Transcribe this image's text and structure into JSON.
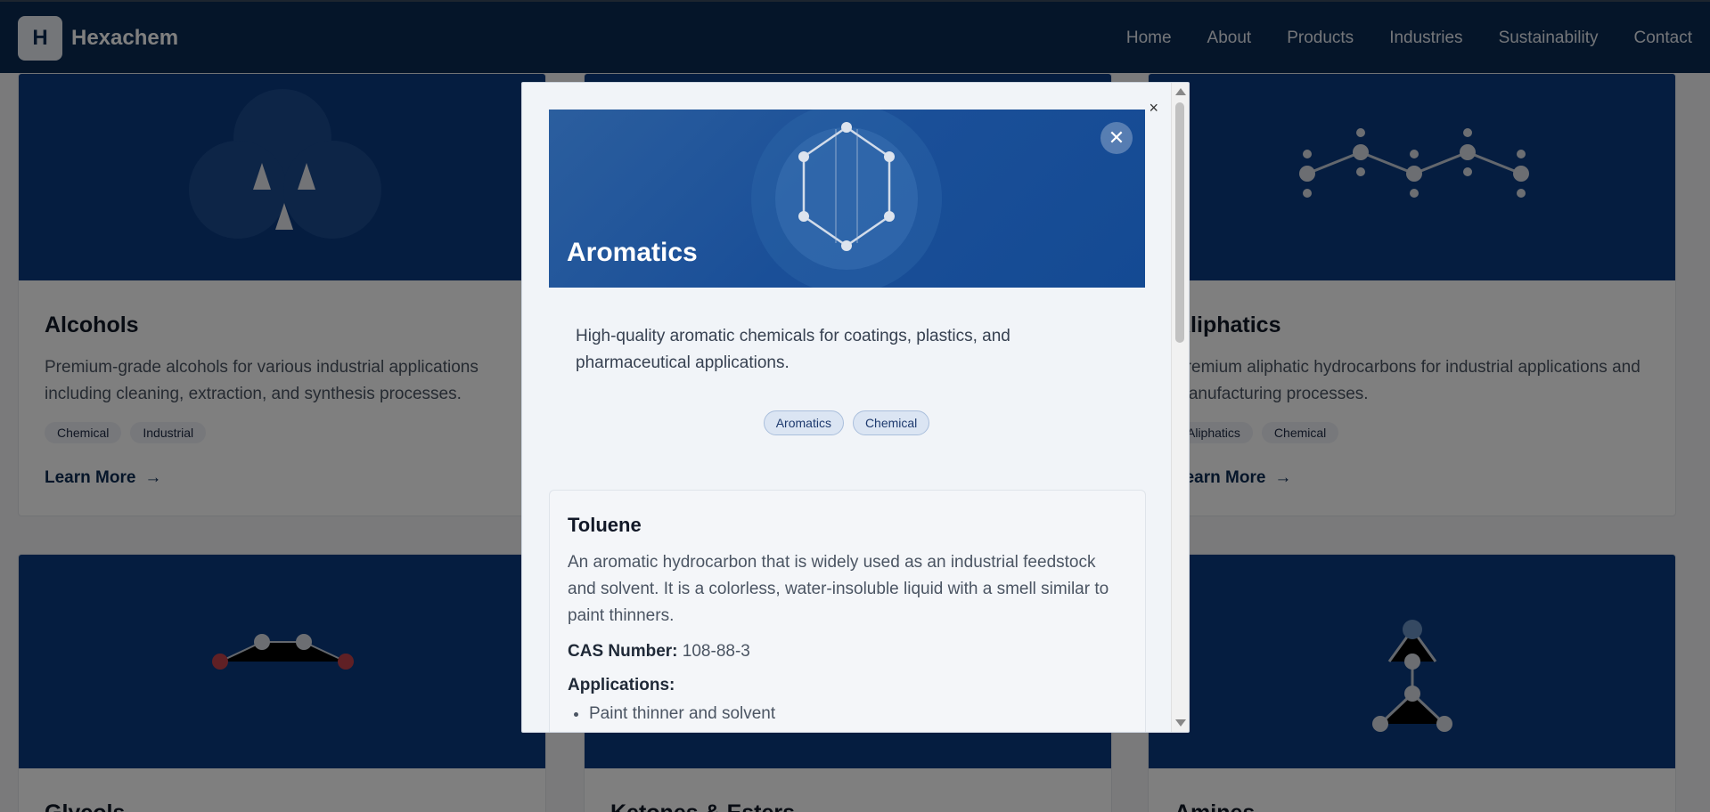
{
  "nav": {
    "logo_letter": "H",
    "brand": "Hexachem",
    "links": [
      "Home",
      "About",
      "Products",
      "Industries",
      "Sustainability",
      "Contact"
    ]
  },
  "cards": [
    {
      "title": "Alcohols",
      "desc": "Premium-grade alcohols for various industrial applications including cleaning, extraction, and synthesis processes.",
      "tags": [
        "Chemical",
        "Industrial"
      ],
      "learn": "Learn More"
    },
    {
      "title": "Aliphatics",
      "desc": "Premium aliphatic hydrocarbons for industrial applications and manufacturing processes.",
      "tags": [
        "Aliphatics",
        "Chemical"
      ],
      "learn": "Learn More"
    },
    {
      "title": "Glycols"
    },
    {
      "title": "Ketones & Esters"
    },
    {
      "title": "Amines"
    }
  ],
  "modal": {
    "outer_close": "×",
    "title": "Aromatics",
    "close_glyph": "✕",
    "description": "High-quality aromatic chemicals for coatings, plastics, and pharmaceutical applications.",
    "tags": [
      "Aromatics",
      "Chemical"
    ],
    "product": {
      "name": "Toluene",
      "description": "An aromatic hydrocarbon that is widely used as an industrial feedstock and solvent. It is a colorless, water-insoluble liquid with a smell similar to paint thinners.",
      "cas_label": "CAS Number:",
      "cas_value": "108-88-3",
      "applications_label": "Applications:",
      "applications": [
        "Paint thinner and solvent"
      ]
    }
  },
  "icons": {
    "learn_more_arrow": "arrow-right-icon",
    "modal_close": "close-icon",
    "molecule": "hexagon-molecule-icon"
  },
  "colors": {
    "navbar": "#0b2a52",
    "hero_blue": "#1a4f98",
    "card_visual": "#0a3a80",
    "overlay": "rgba(0,0,0,0.5)"
  }
}
